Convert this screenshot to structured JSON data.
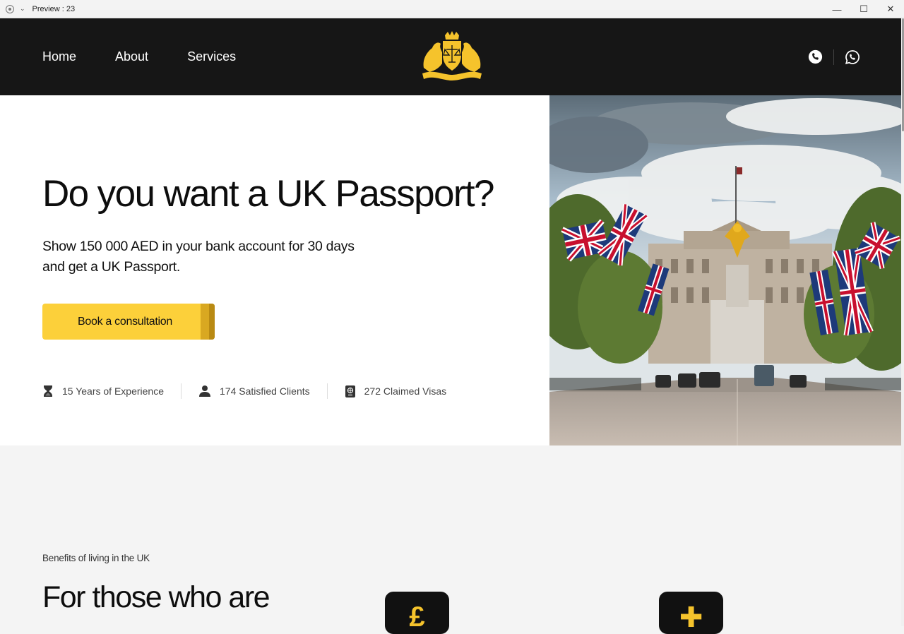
{
  "window": {
    "title": "Preview : 23",
    "controls": {
      "minimize": "—",
      "maximize": "☐",
      "close": "✕"
    }
  },
  "nav": {
    "links": [
      "Home",
      "About",
      "Services"
    ],
    "icons": [
      "phone-icon",
      "whatsapp-icon"
    ]
  },
  "hero": {
    "title": "Do you want a UK Passport?",
    "subtitle": "Show 150 000 AED in your bank account for 30 days and get a UK Passport.",
    "cta_label": "Book a consultation",
    "stats": [
      {
        "icon": "hourglass-icon",
        "label": "15 Years of Experience"
      },
      {
        "icon": "user-icon",
        "label": "174 Satisfied Clients"
      },
      {
        "icon": "passport-icon",
        "label": "272 Claimed Visas"
      }
    ]
  },
  "benefits": {
    "label": "Benefits of living in the UK",
    "title": "For those who are",
    "cards": [
      {
        "icon": "pound-icon",
        "glyph": "£"
      },
      {
        "icon": "plus-icon",
        "glyph": "✚"
      }
    ]
  },
  "colors": {
    "nav_bg": "#161616",
    "accent": "#fcd03a",
    "accent_dark": "#d9a821",
    "page_bg": "#f4f4f4"
  }
}
